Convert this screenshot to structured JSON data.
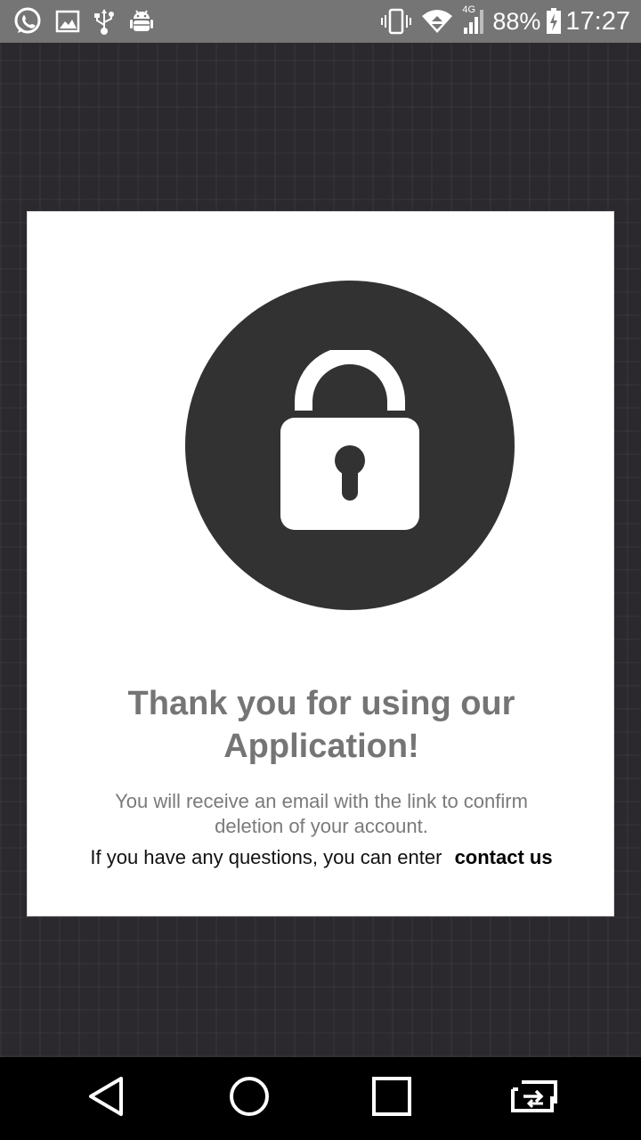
{
  "status_bar": {
    "left_icons": [
      "whatsapp-icon",
      "image-icon",
      "usb-icon",
      "android-debug-icon"
    ],
    "right_icons": [
      "vibrate-icon",
      "wifi-icon",
      "signal-4g-icon",
      "battery-charging-icon"
    ],
    "network_label": "4G",
    "battery_percent": "88%",
    "time": "17:27"
  },
  "card": {
    "title": "Thank you for using our Application!",
    "description": "You will receive an email with the link to confirm deletion of your account.",
    "contact_prefix": "If you have any questions, you can enter",
    "contact_link": "contact us",
    "icon": "lock-icon"
  },
  "nav_bar": {
    "buttons": [
      "back-icon",
      "home-icon",
      "recents-icon",
      "switch-app-icon"
    ]
  },
  "colors": {
    "status_bar": "#757575",
    "background": "#2b282e",
    "card": "#ffffff",
    "lock_circle": "#333233",
    "title_text": "#757575",
    "nav_bar": "#000000"
  }
}
